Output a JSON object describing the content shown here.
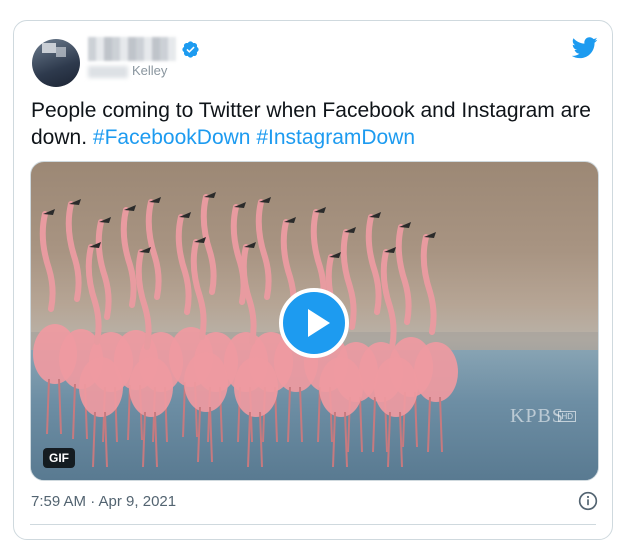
{
  "tweet": {
    "display_name": "",
    "handle_suffix": "Kelley",
    "text_main": "People coming to Twitter when Facebook and Instagram are down.",
    "hashtags": [
      "#FacebookDown",
      "#InstagramDown"
    ],
    "media_badge": "GIF",
    "watermark": "KPBS",
    "watermark_hd": "HD",
    "timestamp": "7:59 AM · Apr 9, 2021"
  },
  "colors": {
    "accent": "#1d9bf0",
    "border": "#cfd9de",
    "muted": "#536471"
  },
  "icons": {
    "brand": "twitter-bird-icon",
    "verified": "verified-badge-icon",
    "play": "play-icon",
    "info": "info-icon"
  }
}
